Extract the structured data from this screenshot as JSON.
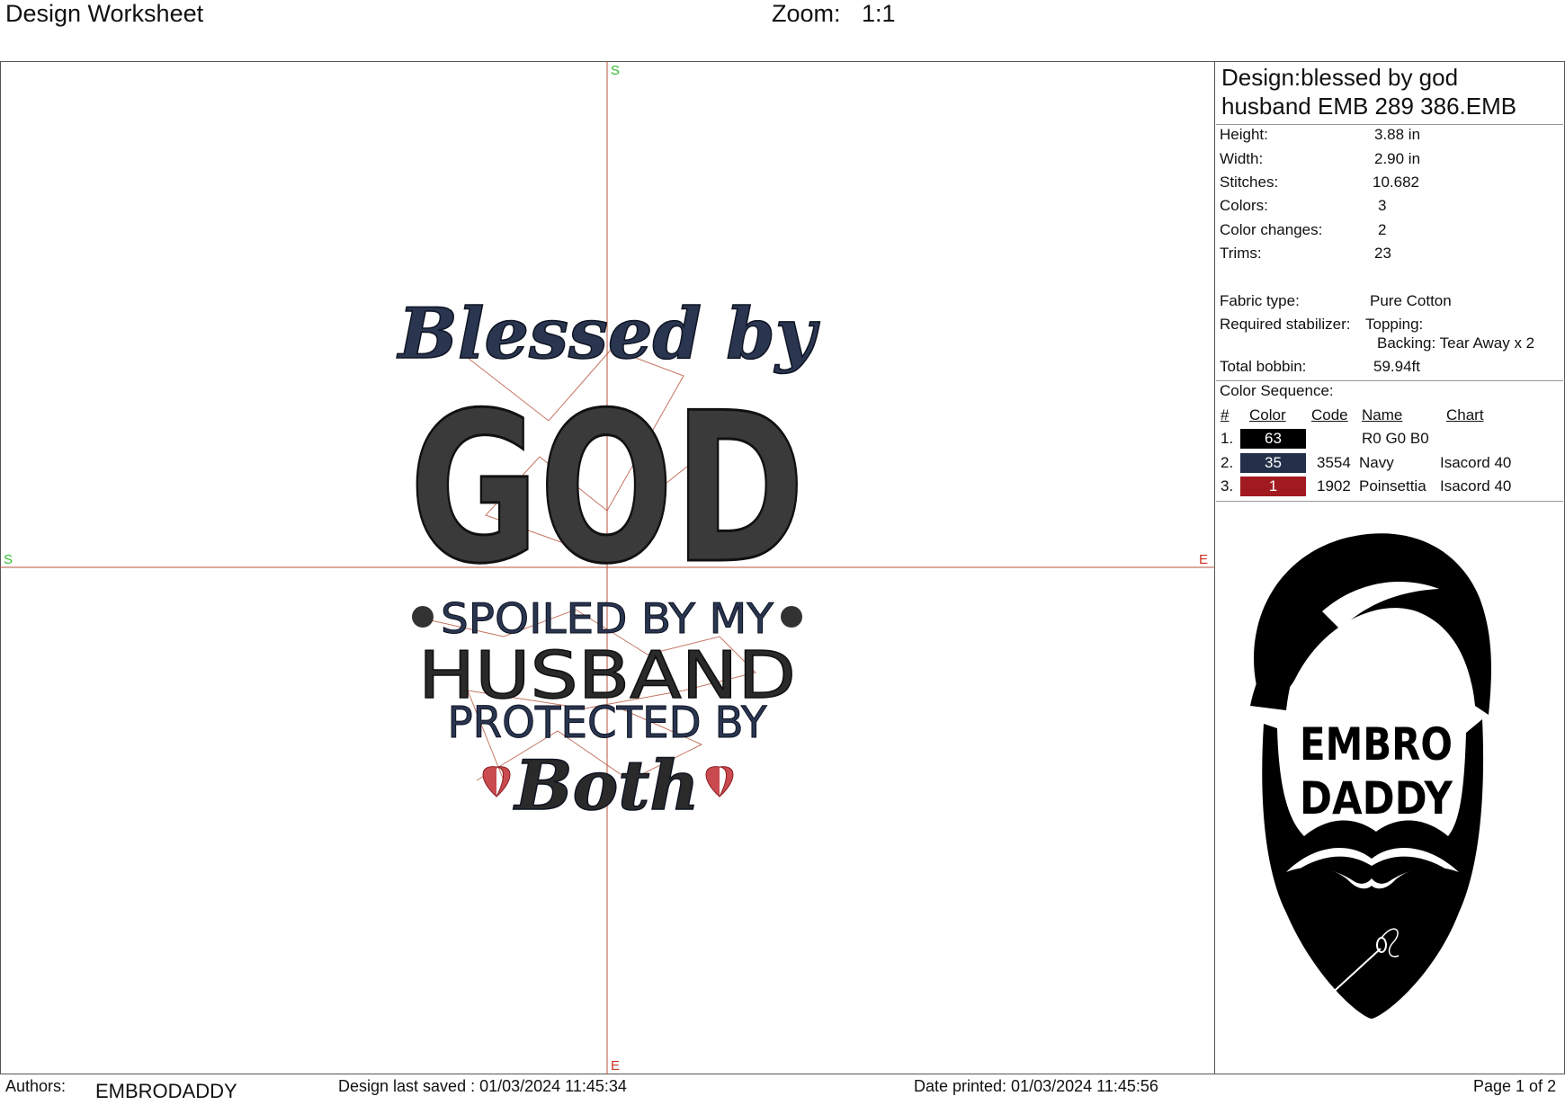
{
  "header": {
    "title": "Design Worksheet",
    "zoom_label": "Zoom:",
    "zoom_value": "1:1"
  },
  "canvas": {
    "axis_markers": {
      "top": "S",
      "bottom": "E",
      "left": "S",
      "right": "E"
    },
    "design_text": {
      "line1": "Blessed by",
      "line2": "GOD",
      "line3": "SPOILED BY MY",
      "line4": "HUSBAND",
      "line5": "PROTECTED BY",
      "line6": "Both"
    }
  },
  "info": {
    "design_name_line1": "Design:blessed by god",
    "design_name_line2": "husband EMB 289 386.EMB",
    "stats": [
      {
        "key": "Height:",
        "value": "3.88 in"
      },
      {
        "key": "Width:",
        "value": "2.90 in"
      },
      {
        "key": "Stitches:",
        "value": "10.682"
      },
      {
        "key": "Colors:",
        "value": "3"
      },
      {
        "key": "Color changes:",
        "value": "2"
      },
      {
        "key": "Trims:",
        "value": "23"
      }
    ],
    "fabric_type_key": "Fabric type:",
    "fabric_type_value": "Pure Cotton",
    "stabilizer_key": "Required stabilizer:",
    "topping": "Topping:",
    "backing": "Backing: Tear Away x 2",
    "bobbin_key": "Total bobbin:",
    "bobbin_value": "59.94ft",
    "color_sequence_title": "Color Sequence:",
    "seq_headers": {
      "num": "#",
      "color": "Color",
      "code": "Code",
      "name": "Name",
      "chart": "Chart"
    },
    "sequence": [
      {
        "num": "1.",
        "swatch_label": "63",
        "swatch_color": "#000000",
        "code": "",
        "name": "R0 G0 B0",
        "chart": ""
      },
      {
        "num": "2.",
        "swatch_label": "35",
        "swatch_color": "#24304a",
        "code": "3554",
        "name": "Navy",
        "chart": "Isacord 40"
      },
      {
        "num": "3.",
        "swatch_label": "1",
        "swatch_color": "#a11a1f",
        "code": "1902",
        "name": "Poinsettia",
        "chart": "Isacord 40"
      }
    ],
    "logo_text": {
      "line1": "EMBRO",
      "line2": "DADDY"
    }
  },
  "footer": {
    "authors_label": "Authors:",
    "authors_value": "EMBRODADDY",
    "last_saved": "Design last saved : 01/03/2024 11:45:34",
    "printed": "Date printed: 01/03/2024 11:45:56",
    "page": "Page 1 of 2"
  },
  "colors": {
    "axis_line": "#b5533b",
    "axis_green": "#33bb33",
    "axis_red": "#cc3322",
    "navy": "#2a3550",
    "dark": "#2a2a2a",
    "red": "#b0262c"
  }
}
